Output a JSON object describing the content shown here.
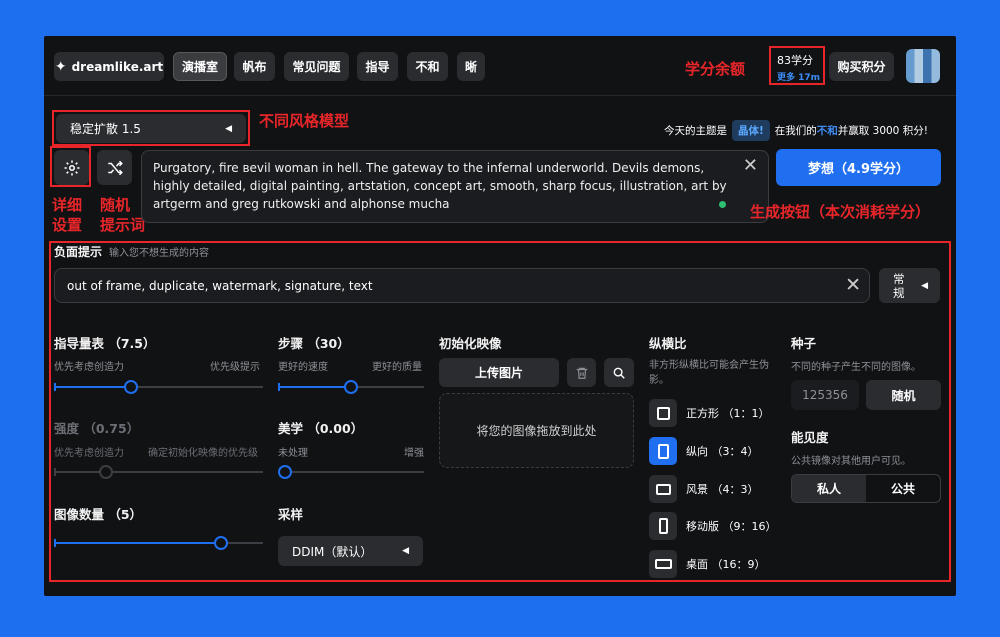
{
  "nav": {
    "logo": "dreamlike.art",
    "items": [
      "演播室",
      "帆布",
      "常见问题",
      "指导",
      "不和",
      "晰"
    ]
  },
  "credits": {
    "value": "83学分",
    "more": "更多 17m"
  },
  "buy_label": "购买积分",
  "annotations": {
    "credits": "学分余额",
    "model": "不同风格模型",
    "settings_1": "详细",
    "settings_2": "设置",
    "random_1": "随机",
    "random_2": "提示词",
    "generate": "生成按钮（本次消耗学分）"
  },
  "model": "稳定扩散 1.5",
  "theme": {
    "before": "今天的主题是",
    "tag": "晶体!",
    "middle": "在我们的",
    "highlight": "不和",
    "after": "并赢取 3000 积分!"
  },
  "prompt": "Purgatory, fire вevil woman in hell. The gateway to the infernal underworld. Devils demons, highly detailed, digital painting, artstation, concept art, smooth, sharp focus, illustration, art by artgerm and greg rutkowski and alphonse mucha",
  "dream_label": "梦想（4.9学分）",
  "negative": {
    "label": "负面提示",
    "hint": "输入您不想生成的内容",
    "value": "out of frame, duplicate, watermark, signature, text",
    "mode_1": "常",
    "mode_2": "规"
  },
  "guidance": {
    "label": "指导量表 （7.5）",
    "left": "优先考虑创造力",
    "right": "优先级提示",
    "value": 7.5,
    "position": 0.37
  },
  "strength": {
    "label": "强度 （0.75）",
    "left": "优先考虑创造力",
    "right": "确定初始化映像的优先级",
    "value": 0.75,
    "position": 0.25
  },
  "count": {
    "label": "图像数量 （5）",
    "value": 5,
    "position": 0.8
  },
  "steps": {
    "label": "步骤 （30）",
    "left": "更好的速度",
    "right": "更好的质量",
    "value": 30,
    "position": 0.5
  },
  "aesthetic": {
    "label": "美学 （0.00）",
    "left": "未处理",
    "right": "增强",
    "value": 0.0,
    "position": 0.0
  },
  "sampler": {
    "label": "采样",
    "value": "DDIM（默认）"
  },
  "init_image": {
    "label": "初始化映像",
    "upload": "上传图片",
    "drop": "将您的图像拖放到此处"
  },
  "aspect": {
    "label": "纵横比",
    "hint_1": "非方形纵横比可能会产生伪",
    "hint_2": "影。",
    "options": [
      "正方形 （1：1）",
      "纵向 （3：4）",
      "风景 （4：3）",
      "移动版 （9：16）",
      "桌面 （16：9）"
    ],
    "selected_index": 1
  },
  "seed": {
    "label": "种子",
    "hint": "不同的种子产生不同的图像。",
    "value": "125356",
    "random": "随机"
  },
  "visibility": {
    "label": "能见度",
    "hint": "公共镜像对其他用户可见。",
    "options": [
      "私人",
      "公共"
    ],
    "selected": "私人"
  },
  "colors": {
    "accent": "#1f6ff0",
    "annotation": "#e8262a",
    "background": "#111214",
    "frame": "#1e6ff0"
  }
}
